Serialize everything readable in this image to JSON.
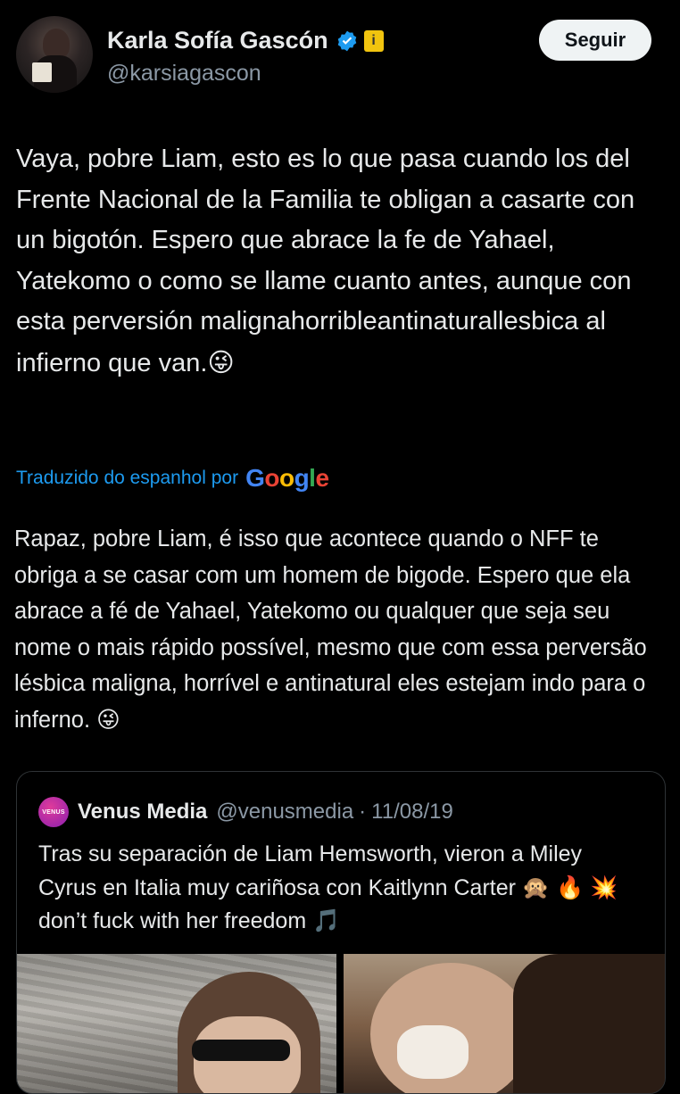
{
  "author": {
    "name": "Karla Sofía Gascón",
    "handle": "@karsiagascon",
    "affiliation_icon": "info-badge-icon",
    "verified": true,
    "follow_label": "Seguir"
  },
  "tweet": {
    "text": "Vaya, pobre Liam, esto es lo que pasa cuando los del Frente Nacional de la Familia te obligan a casarte con un bigotón. Espero que abrace la fe de Yahael, Yatekomo o como se llame cuanto antes, aunque con esta perversión malignahorribleantinaturallesbica al infierno que van.",
    "emoji": "😜"
  },
  "translation": {
    "label": "Traduzido do espanhol por",
    "provider": "Google",
    "text": "Rapaz, pobre Liam, é isso que acontece quando o NFF te obriga a se casar com um homem de bigode. Espero que ela abrace a fé de Yahael, Yatekomo ou qualquer que seja seu nome o mais rápido possível, mesmo que com essa perversão lésbica maligna, horrível e antinatural eles estejam indo para o inferno.",
    "emoji": "😜"
  },
  "quote": {
    "avatar_text": "VENUS",
    "name": "Venus Media",
    "handle": "@venusmedia",
    "separator": "·",
    "date": "11/08/19",
    "text": "Tras su separación de Liam Hemsworth, vieron a Miley Cyrus en Italia muy cariñosa con Kaitlynn Carter 🙊 🔥 💥 don’t fuck with her freedom 🎵"
  },
  "colors": {
    "background": "#000000",
    "link": "#1d9bf0",
    "secondary_text": "#8b98a5",
    "verified": "#1d9bf0"
  }
}
